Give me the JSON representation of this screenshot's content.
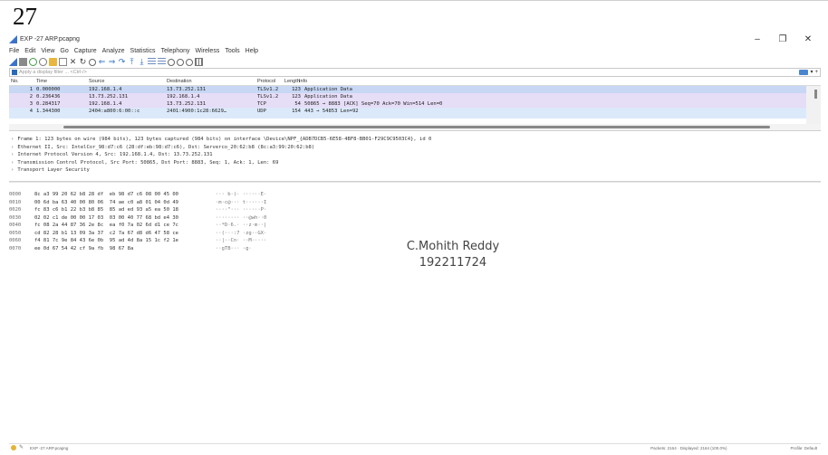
{
  "page_number": "27",
  "window": {
    "title": "EXP -27 ARP.pcapng",
    "controls": [
      "–",
      "❐",
      "✕"
    ]
  },
  "menu": [
    "File",
    "Edit",
    "View",
    "Go",
    "Capture",
    "Analyze",
    "Statistics",
    "Telephony",
    "Wireless",
    "Tools",
    "Help"
  ],
  "filter": {
    "placeholder": "Apply a display filter ... <Ctrl-/>"
  },
  "packet_list": {
    "columns": [
      "No.",
      "Time",
      "Source",
      "Destination",
      "Protocol",
      "Length",
      "Info"
    ],
    "rows": [
      {
        "no": "1",
        "time": "0.000000",
        "src": "192.168.1.4",
        "dst": "13.73.252.131",
        "proto": "TLSv1.2",
        "len": "123",
        "info": "Application Data"
      },
      {
        "no": "2",
        "time": "0.236436",
        "src": "13.73.252.131",
        "dst": "192.168.1.4",
        "proto": "TLSv1.2",
        "len": "123",
        "info": "Application Data"
      },
      {
        "no": "3",
        "time": "0.284317",
        "src": "192.168.1.4",
        "dst": "13.73.252.131",
        "proto": "TCP",
        "len": "54",
        "info": "50865 → 8883 [ACK] Seq=70 Ack=70 Win=514 Len=0"
      },
      {
        "no": "4",
        "time": "1.344300",
        "src": "2404:a800:6:00::c",
        "dst": "2401:4900:1c28:6629…",
        "proto": "UDP",
        "len": "154",
        "info": "443 → 54853 Len=92"
      }
    ]
  },
  "details": [
    "Frame 1: 123 bytes on wire (984 bits), 123 bytes captured (984 bits) on interface \\Device\\NPF_{ADB7DCB5-6E58-4BF8-BB01-F29C9C9503C4}, id 0",
    "Ethernet II, Src: IntelCor_98:d7:c6 (28:df:eb:98:d7:c6), Dst: Serverco_20:62:b8 (8c:a3:99:20:62:b8)",
    "Internet Protocol Version 4, Src: 192.168.1.4, Dst: 13.73.252.131",
    "Transmission Control Protocol, Src Port: 50865, Dst Port: 8883, Seq: 1, Ack: 1, Len: 69",
    "Transport Layer Security"
  ],
  "bytes": [
    {
      "off": "0000",
      "hex": "8c a3 99 20 62 b8 28 df  eb 98 d7 c6 08 00 45 00",
      "ascii": "··· b·(· ······E·"
    },
    {
      "off": "0010",
      "hex": "00 6d ba 63 40 00 80 06  74 ae c0 a8 01 04 0d 49",
      "ascii": "·m·c@··· t······I"
    },
    {
      "off": "0020",
      "hex": "fc 83 c6 b1 22 b3 b8 85  85 ad ed 93 a5 ea 50 18",
      "ascii": "····\"··· ······P·"
    },
    {
      "off": "0030",
      "hex": "02 02 c1 de 00 00 17 03  03 00 40 77 68 bd e4 30",
      "ascii": "········ ··@wh··0"
    },
    {
      "off": "0040",
      "hex": "fc 08 2a 44 87 36 2e 8c  ea f0 7a 02 6d d1 ce 7c",
      "ascii": "··*D·6.· ··z·m··|"
    },
    {
      "off": "0050",
      "hex": "cd 82 28 b1 13 09 3a 37  c2 7a 67 d8 d6 47 58 ce",
      "ascii": "··(···:7 ·zg··GX·"
    },
    {
      "off": "0060",
      "hex": "f4 81 7c 9e 84 43 6e 0b  95 ad 4d 8a 15 1c f2 1e",
      "ascii": "··|··Cn· ··M·····"
    },
    {
      "off": "0070",
      "hex": "ee 0d 67 54 42 cf 9a fb  98 67 8a",
      "ascii": "··gTB··· ·g·"
    }
  ],
  "watermark": {
    "name": "C.Mohith Reddy",
    "id": "192211724"
  },
  "status": {
    "file": "EXP -27 ARP.pcapng",
    "packets": "Packets: 2164 · Displayed: 2164 (100.0%)",
    "profile": "Profile: Default"
  }
}
